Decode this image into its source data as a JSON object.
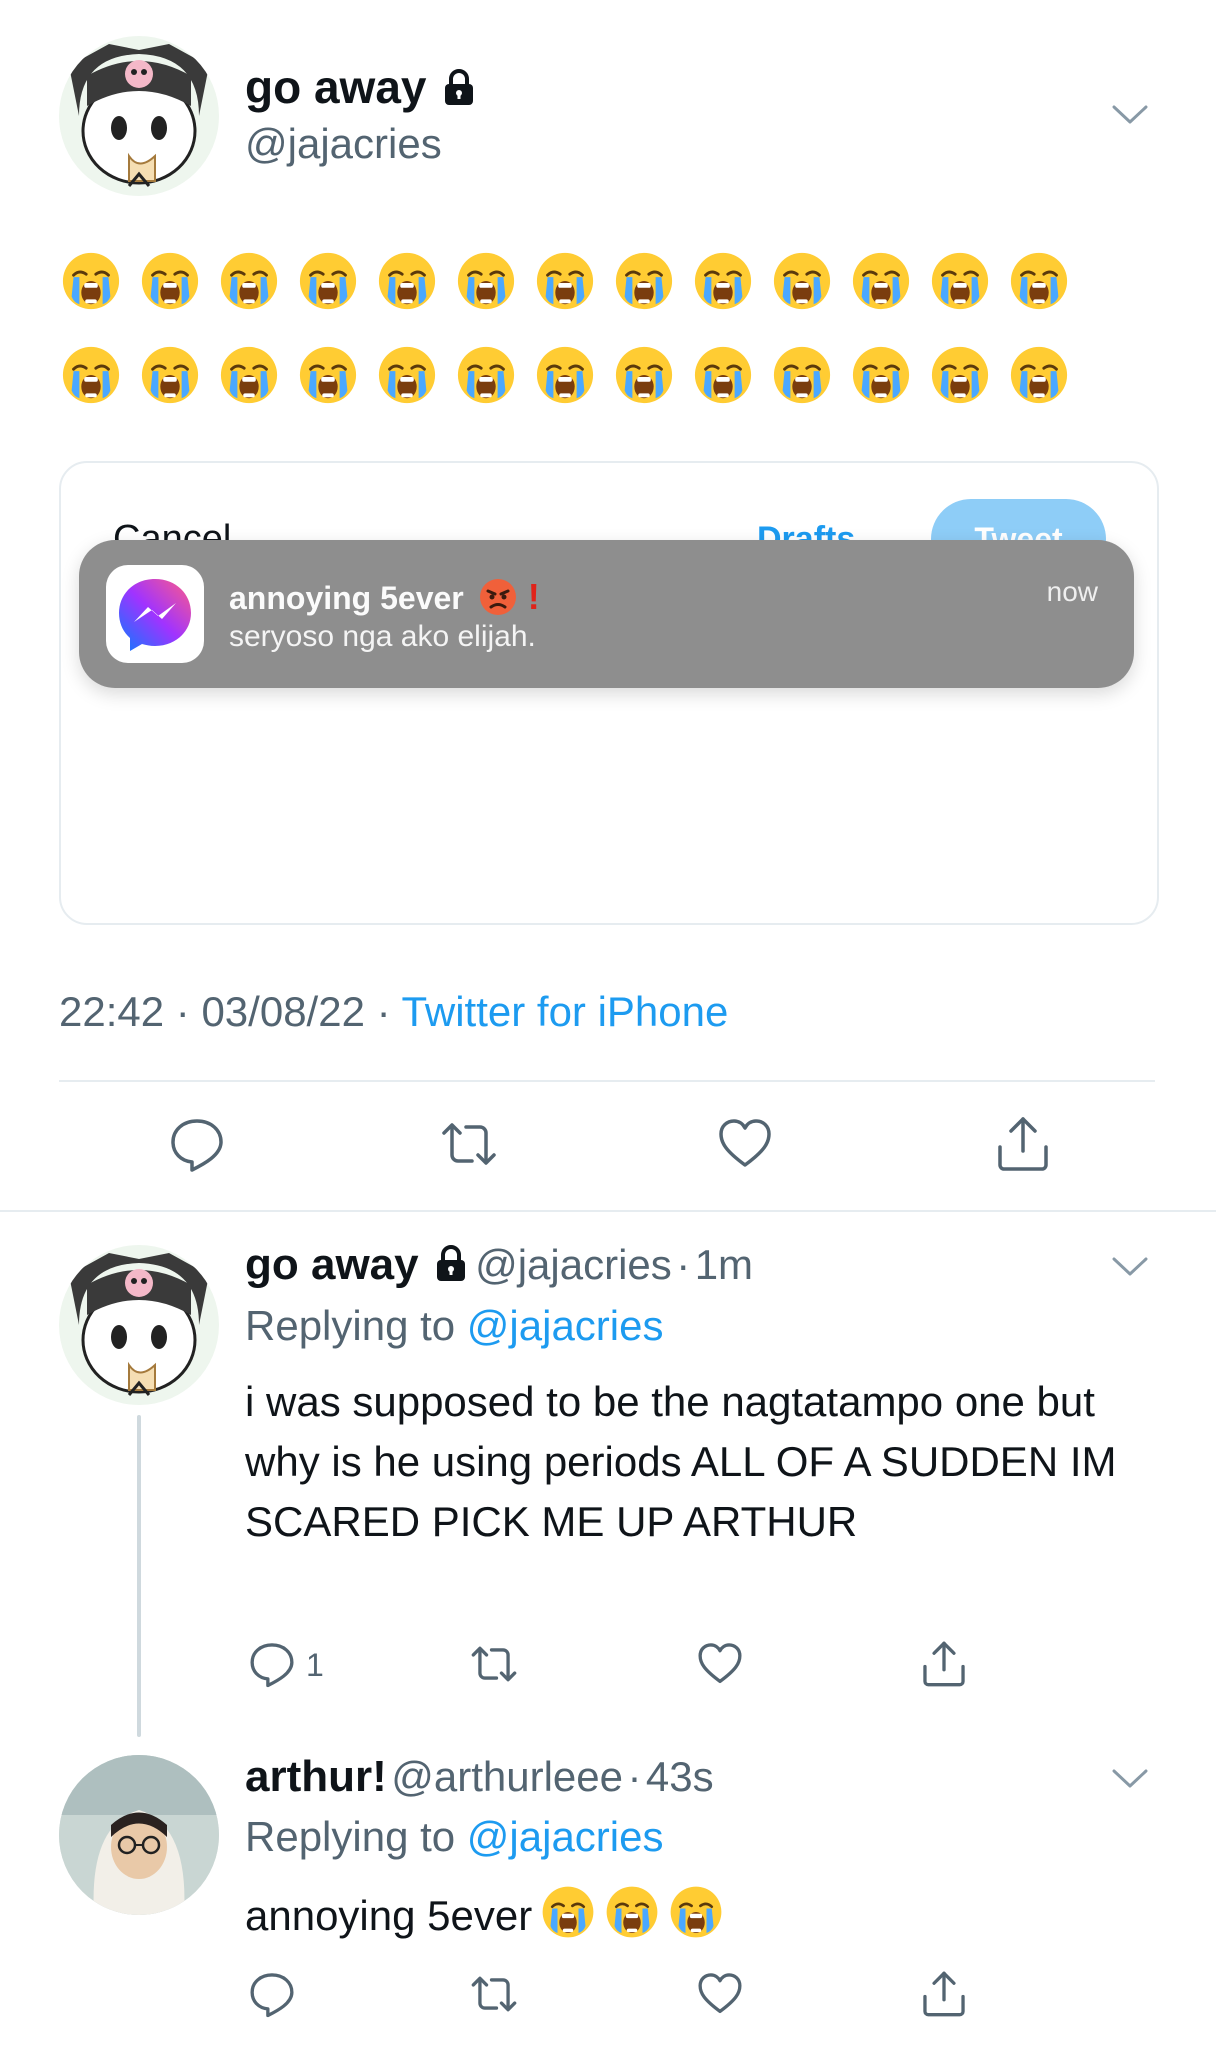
{
  "main_tweet": {
    "display_name": "go away",
    "handle": "@jajacries",
    "emoji_rows": [
      13,
      13
    ],
    "emoji_name": "loudly-crying-face",
    "embedded_screenshot": {
      "cancel_label": "Cancel",
      "drafts_label": "Drafts",
      "tweet_label": "Tweet",
      "notification": {
        "app": "messenger",
        "title": "annoying 5ever",
        "body": "seryoso nga ako elijah.",
        "time": "now"
      }
    },
    "time": "22:42",
    "date": "03/08/22",
    "separator": "·",
    "source": "Twitter for iPhone"
  },
  "replies": [
    {
      "display_name": "go away",
      "handle": "@jajacries",
      "age": "1m",
      "replying_prefix": "Replying to",
      "replying_to": "@jajacries",
      "text": "i was supposed to be the nagtatampo one but why is he using periods ALL OF A SUDDEN IM SCARED PICK ME UP ARTHUR",
      "reply_count": "1"
    },
    {
      "display_name": "arthur!",
      "handle": "@arthurleee",
      "age": "43s",
      "replying_prefix": "Replying to",
      "replying_to": "@jajacries",
      "text": "annoying 5ever",
      "trailing_emoji_count": 3
    }
  ],
  "colors": {
    "accent": "#1d9bf0",
    "secondary_text": "#536471",
    "divider": "#e6ecf0",
    "notification_bg": "#8e8e8e"
  }
}
